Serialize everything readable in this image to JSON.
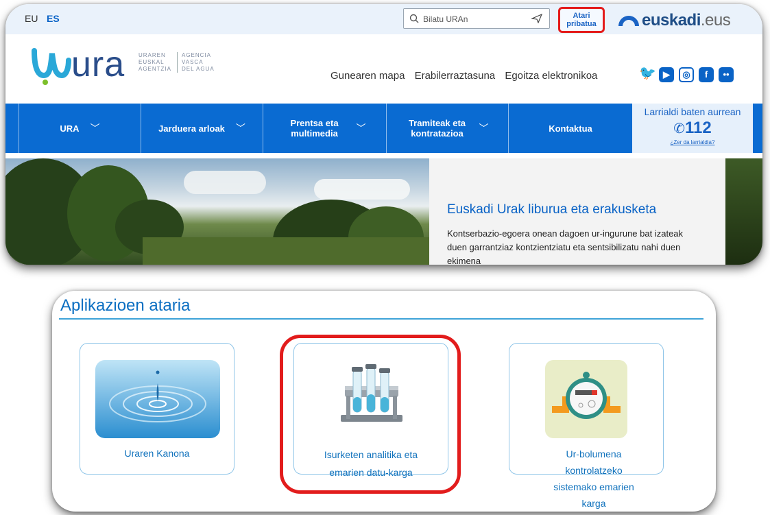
{
  "header": {
    "lang_eu": "EU",
    "lang_es": "ES",
    "search_placeholder": "Bilatu URAn",
    "atari_line1": "Atari",
    "atari_line2": "pribatua",
    "euskadi_brand": "euskadi",
    "euskadi_tld": ".eus"
  },
  "logo": {
    "word": "ura",
    "sub1": [
      "URAREN",
      "EUSKAL",
      "AGENTZIA"
    ],
    "sub2": [
      "AGENCIA",
      "VASCA",
      "DEL AGUA"
    ]
  },
  "util_links": [
    "Gunearen mapa",
    "Erabilerraztasuna",
    "Egoitza elektronikoa"
  ],
  "social_icons": [
    "twitter-icon",
    "youtube-icon",
    "instagram-icon",
    "facebook-icon",
    "flickr-icon"
  ],
  "nav": [
    {
      "label": "URA",
      "chevron": true
    },
    {
      "label": "Jarduera arloak",
      "chevron": true
    },
    {
      "label": "Prentsa eta multimedia",
      "chevron": true
    },
    {
      "label": "Tramiteak eta kontratazioa",
      "chevron": true
    },
    {
      "label": "Kontaktua",
      "chevron": false
    }
  ],
  "emergency": {
    "title": "Larrialdi baten aurrean",
    "number": "112",
    "link": "¿Zer da larrialdia?"
  },
  "banner": {
    "title": "Euskadi Urak liburua eta erakusketa",
    "description": "Kontserbazio-egoera onean dagoen ur-ingurune bat izateak duen garrantziaz kontzientziatu eta sentsibilizatu nahi duen ekimena"
  },
  "portal": {
    "title": "Aplikazioen ataria",
    "cards": [
      {
        "label": "Uraren Kanona",
        "icon": "water-drop-icon"
      },
      {
        "label_line1": "Isurketen analitika eta",
        "label_line2": "emarien datu-karga",
        "icon": "test-tubes-icon"
      },
      {
        "label_lines": [
          "Ur-bolumena",
          "kontrolatzeko",
          "sistemako emarien",
          "karga"
        ],
        "icon": "water-meter-icon"
      }
    ]
  },
  "colors": {
    "primary_blue": "#0a6bd2",
    "highlight_red": "#e21c1c",
    "link_blue": "#1273bd"
  }
}
